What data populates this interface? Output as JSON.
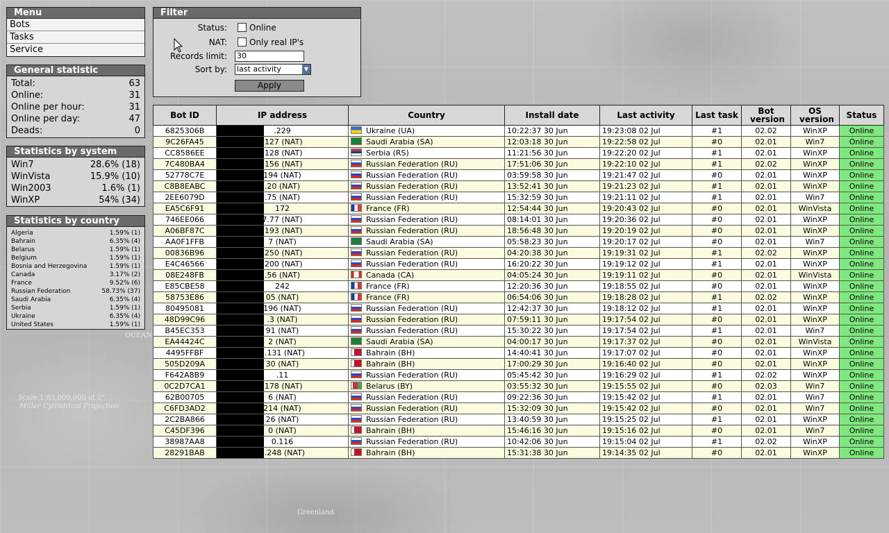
{
  "menu": {
    "title": "Menu",
    "items": [
      "Bots",
      "Tasks",
      "Service"
    ]
  },
  "general": {
    "title": "General statistic",
    "rows": [
      {
        "label": "Total:",
        "value": "63"
      },
      {
        "label": "Online:",
        "value": "31"
      },
      {
        "label": "Online per hour:",
        "value": "31"
      },
      {
        "label": "Online per day:",
        "value": "47"
      },
      {
        "label": "Deads:",
        "value": "0"
      }
    ]
  },
  "by_system": {
    "title": "Statistics by system",
    "rows": [
      {
        "name": "Win7",
        "value": "28.6% (18)"
      },
      {
        "name": "WinVista",
        "value": "15.9% (10)"
      },
      {
        "name": "Win2003",
        "value": "1.6% (1)"
      },
      {
        "name": "WinXP",
        "value": "54% (34)"
      }
    ]
  },
  "by_country": {
    "title": "Statistics by country",
    "rows": [
      {
        "name": "Algeria",
        "value": "1.59% (1)"
      },
      {
        "name": "Bahrain",
        "value": "6.35% (4)"
      },
      {
        "name": "Belarus",
        "value": "1.59% (1)"
      },
      {
        "name": "Belgium",
        "value": "1.59% (1)"
      },
      {
        "name": "Bosnia and Herzegovina",
        "value": "1.59% (1)"
      },
      {
        "name": "Canada",
        "value": "3.17% (2)"
      },
      {
        "name": "France",
        "value": "9.52% (6)"
      },
      {
        "name": "Russian Federation",
        "value": "58.73% (37)"
      },
      {
        "name": "Saudi Arabia",
        "value": "6.35% (4)"
      },
      {
        "name": "Serbia",
        "value": "1.59% (1)"
      },
      {
        "name": "Ukraine",
        "value": "6.35% (4)"
      },
      {
        "name": "United States",
        "value": "1.59% (1)"
      }
    ]
  },
  "filter": {
    "title": "Filter",
    "status_label": "Status:",
    "status_option": "Online",
    "nat_label": "NAT:",
    "nat_option": "Only real IP's",
    "records_label": "Records limit:",
    "records_value": "30",
    "sort_label": "Sort by:",
    "sort_value": "last activity",
    "apply_label": "Apply"
  },
  "table": {
    "headers": [
      "Bot ID",
      "IP address",
      "Country",
      "Install date",
      "Last activity",
      "Last task",
      "Bot version",
      "OS version",
      "Status"
    ],
    "rows": [
      {
        "id": "6825306B",
        "ip": ".229",
        "flag": "UA",
        "country": "Ukraine (UA)",
        "install": "10:22:37 30 Jun",
        "last": "19:23:08 02 Jul",
        "task": "#1",
        "ver": "02.02",
        "os": "WinXP",
        "status": "Online"
      },
      {
        "id": "9C26FA45",
        "ip": ".127 (NAT)",
        "flag": "SA",
        "country": "Saudi Arabia (SA)",
        "install": "12:03:18 30 Jun",
        "last": "19:22:58 02 Jul",
        "task": "#0",
        "ver": "02.01",
        "os": "Win7",
        "status": "Online"
      },
      {
        "id": "CC8586EE",
        "ip": ".128 (NAT)",
        "flag": "RS",
        "country": "Serbia (RS)",
        "install": "11:21:56 30 Jun",
        "last": "19:22:20 02 Jul",
        "task": "#1",
        "ver": "02.01",
        "os": "WinXP",
        "status": "Online"
      },
      {
        "id": "7C480BA4",
        "ip": ".156 (NAT)",
        "flag": "RU",
        "country": "Russian Federation (RU)",
        "install": "17:51:06 30 Jun",
        "last": "19:22:10 02 Jul",
        "task": "#1",
        "ver": "02.02",
        "os": "WinXP",
        "status": "Online"
      },
      {
        "id": "52778C7E",
        "ip": "194 (NAT)",
        "flag": "RU",
        "country": "Russian Federation (RU)",
        "install": "03:59:58 30 Jun",
        "last": "19:21:47 02 Jul",
        "task": "#0",
        "ver": "02.01",
        "os": "WinXP",
        "status": "Online"
      },
      {
        "id": "C8B8EABC",
        "ip": ".20 (NAT)",
        "flag": "RU",
        "country": "Russian Federation (RU)",
        "install": "13:52:41 30 Jun",
        "last": "19:21:23 02 Jul",
        "task": "#1",
        "ver": "02.01",
        "os": "WinXP",
        "status": "Online"
      },
      {
        "id": "2EE6079D",
        "ip": ".75 (NAT)",
        "flag": "RU",
        "country": "Russian Federation (RU)",
        "install": "15:32:59 30 Jun",
        "last": "19:21:11 02 Jul",
        "task": "#1",
        "ver": "02.01",
        "os": "Win7",
        "status": "Online"
      },
      {
        "id": "EA5C6F91",
        "ip": "172",
        "flag": "FR",
        "country": "France (FR)",
        "install": "12:54:44 30 Jun",
        "last": "19:20:43 02 Jul",
        "task": "#0",
        "ver": "02.01",
        "os": "WinVista",
        "status": "Online"
      },
      {
        "id": "746EE066",
        "ip": "7.77 (NAT)",
        "flag": "RU",
        "country": "Russian Federation (RU)",
        "install": "08:14:01 30 Jun",
        "last": "19:20:36 02 Jul",
        "task": "#0",
        "ver": "02.01",
        "os": "WinXP",
        "status": "Online"
      },
      {
        "id": "A06BF87C",
        "ip": ".193 (NAT)",
        "flag": "RU",
        "country": "Russian Federation (RU)",
        "install": "18:56:48 30 Jun",
        "last": "19:20:19 02 Jul",
        "task": "#0",
        "ver": "02.01",
        "os": "WinXP",
        "status": "Online"
      },
      {
        "id": "AA0F1FFB",
        "ip": "7 (NAT)",
        "flag": "SA",
        "country": "Saudi Arabia (SA)",
        "install": "05:58:23 30 Jun",
        "last": "19:20:17 02 Jul",
        "task": "#0",
        "ver": "02.01",
        "os": "Win7",
        "status": "Online"
      },
      {
        "id": "00836B96",
        "ip": ".250 (NAT)",
        "flag": "RU",
        "country": "Russian Federation (RU)",
        "install": "04:20:38 30 Jun",
        "last": "19:19:31 02 Jul",
        "task": "#1",
        "ver": "02.02",
        "os": "WinXP",
        "status": "Online"
      },
      {
        "id": "E4C46566",
        "ip": ".200 (NAT)",
        "flag": "RU",
        "country": "Russian Federation (RU)",
        "install": "16:20:22 30 Jun",
        "last": "19:19:12 02 Jul",
        "task": "#1",
        "ver": "02.01",
        "os": "WinXP",
        "status": "Online"
      },
      {
        "id": "08E248FB",
        "ip": ".56 (NAT)",
        "flag": "CA",
        "country": "Canada (CA)",
        "install": "04:05:24 30 Jun",
        "last": "19:19:11 02 Jul",
        "task": "#0",
        "ver": "02.01",
        "os": "WinVista",
        "status": "Online"
      },
      {
        "id": "E85CBE58",
        "ip": "242",
        "flag": "FR",
        "country": "France (FR)",
        "install": "12:20:36 30 Jun",
        "last": "19:18:55 02 Jul",
        "task": "#0",
        "ver": "02.01",
        "os": "WinXP",
        "status": "Online"
      },
      {
        "id": "58753E86",
        "ip": "05 (NAT)",
        "flag": "FR",
        "country": "France (FR)",
        "install": "06:54:06 30 Jun",
        "last": "19:18:28 02 Jul",
        "task": "#1",
        "ver": "02.02",
        "os": "WinXP",
        "status": "Online"
      },
      {
        "id": "80495081",
        "ip": "196 (NAT)",
        "flag": "RU",
        "country": "Russian Federation (RU)",
        "install": "12:42:37 30 Jun",
        "last": "19:18:12 02 Jul",
        "task": "#1",
        "ver": "02.01",
        "os": "WinXP",
        "status": "Online"
      },
      {
        "id": "48D99C96",
        "ip": ".3 (NAT)",
        "flag": "RU",
        "country": "Russian Federation (RU)",
        "install": "07:59:11 30 Jun",
        "last": "19:17:54 02 Jul",
        "task": "#0",
        "ver": "02.01",
        "os": "WinXP",
        "status": "Online"
      },
      {
        "id": "B45EC353",
        "ip": "91 (NAT)",
        "flag": "RU",
        "country": "Russian Federation (RU)",
        "install": "15:30:22 30 Jun",
        "last": "19:17:54 02 Jul",
        "task": "#1",
        "ver": "02.01",
        "os": "Win7",
        "status": "Online"
      },
      {
        "id": "EA44424C",
        "ip": "2 (NAT)",
        "flag": "SA",
        "country": "Saudi Arabia (SA)",
        "install": "04:00:17 30 Jun",
        "last": "19:17:37 02 Jul",
        "task": "#0",
        "ver": "02.01",
        "os": "WinVista",
        "status": "Online"
      },
      {
        "id": "4495FFBF",
        "ip": "8.131 (NAT)",
        "flag": "BH",
        "country": "Bahrain (BH)",
        "install": "14:40:41 30 Jun",
        "last": "19:17:07 02 Jul",
        "task": "#0",
        "ver": "02.01",
        "os": "WinXP",
        "status": "Online"
      },
      {
        "id": "505D209A",
        "ip": "30 (NAT)",
        "flag": "BH",
        "country": "Bahrain (BH)",
        "install": "17:00:29 30 Jun",
        "last": "19:16:40 02 Jul",
        "task": "#0",
        "ver": "02.01",
        "os": "WinXP",
        "status": "Online"
      },
      {
        "id": "F642A8B9",
        "ip": ".11",
        "flag": "RU",
        "country": "Russian Federation (RU)",
        "install": "05:45:42 30 Jun",
        "last": "19:16:29 02 Jul",
        "task": "#1",
        "ver": "02.02",
        "os": "WinXP",
        "status": "Online"
      },
      {
        "id": "0C2D7CA1",
        "ip": ".178 (NAT)",
        "flag": "BY",
        "country": "Belarus (BY)",
        "install": "03:55:32 30 Jun",
        "last": "19:15:55 02 Jul",
        "task": "#0",
        "ver": "02.03",
        "os": "Win7",
        "status": "Online"
      },
      {
        "id": "62B00705",
        "ip": "6 (NAT)",
        "flag": "RU",
        "country": "Russian Federation (RU)",
        "install": "09:22:36 30 Jun",
        "last": "19:15:42 02 Jul",
        "task": "#1",
        "ver": "02.01",
        "os": "Win7",
        "status": "Online"
      },
      {
        "id": "C6FD3AD2",
        "ip": "214 (NAT)",
        "flag": "RU",
        "country": "Russian Federation (RU)",
        "install": "15:32:09 30 Jun",
        "last": "19:15:42 02 Jul",
        "task": "#0",
        "ver": "02.01",
        "os": "Win7",
        "status": "Online"
      },
      {
        "id": "2C2BA866",
        "ip": "26 (NAT)",
        "flag": "RU",
        "country": "Russian Federation (RU)",
        "install": "13:40:59 30 Jun",
        "last": "19:15:25 02 Jul",
        "task": "#1",
        "ver": "02.01",
        "os": "WinXP",
        "status": "Online"
      },
      {
        "id": "C45DF396",
        "ip": "0 (NAT)",
        "flag": "BH",
        "country": "Bahrain (BH)",
        "install": "15:46:16 30 Jun",
        "last": "19:15:16 02 Jul",
        "task": "#0",
        "ver": "02.01",
        "os": "Win7",
        "status": "Online"
      },
      {
        "id": "38987AA8",
        "ip": "0.116",
        "flag": "RU",
        "country": "Russian Federation (RU)",
        "install": "10:42:06 30 Jun",
        "last": "19:15:04 02 Jul",
        "task": "#1",
        "ver": "02.02",
        "os": "WinXP",
        "status": "Online"
      },
      {
        "id": "28291BAB",
        "ip": "6.248 (NAT)",
        "flag": "BH",
        "country": "Bahrain (BH)",
        "install": "15:31:38 30 Jun",
        "last": "19:14:35 02 Jul",
        "task": "#0",
        "ver": "02.01",
        "os": "WinXP",
        "status": "Online"
      }
    ]
  },
  "background": {
    "caption_scale": "Scale 1:83,000,000 at 0°",
    "caption_projection": "Miller Cylindrical Projection",
    "caption_ocean": "OCEAN",
    "caption_greenland": "Greenland"
  },
  "colors": {
    "status_online": "#7fe87f",
    "panel_title_bg": "#6a6a6a",
    "row_alt_bg": "#fbfbe0"
  }
}
